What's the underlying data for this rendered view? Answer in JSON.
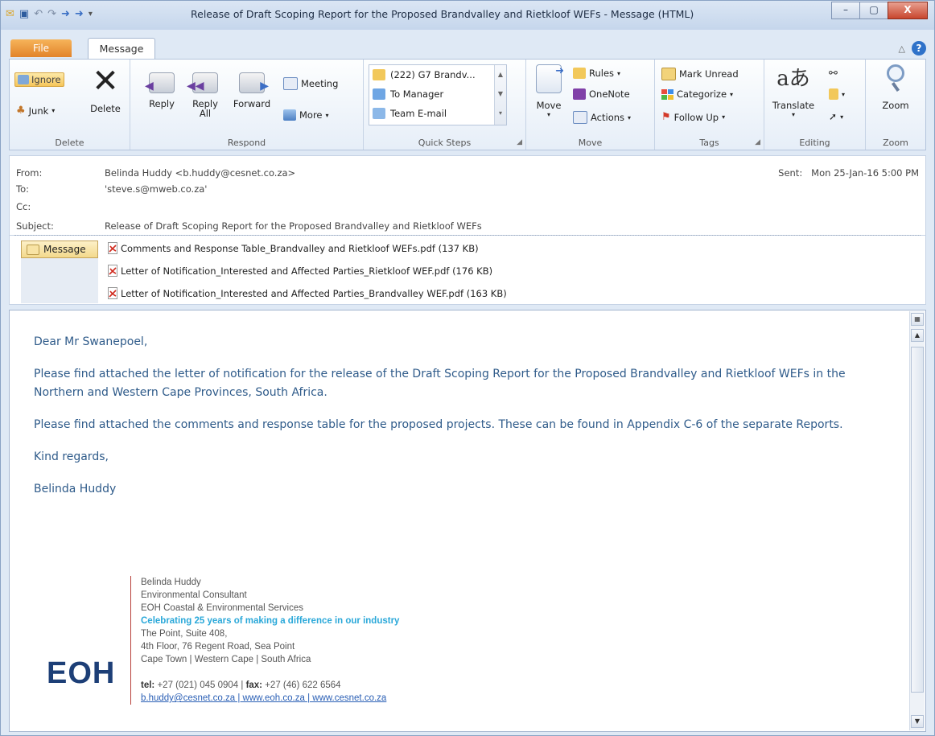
{
  "window": {
    "title": "Release of Draft Scoping Report for the Proposed Brandvalley and Rietkloof WEFs - Message (HTML)",
    "controls": [
      "–",
      "▢",
      "X"
    ]
  },
  "tabs": {
    "file": "File",
    "message": "Message"
  },
  "ribbon": {
    "delete_group": {
      "label": "Delete",
      "ignore": "Ignore",
      "junk": "Junk",
      "delete": "Delete"
    },
    "respond_group": {
      "label": "Respond",
      "reply": "Reply",
      "reply_all_1": "Reply",
      "reply_all_2": "All",
      "forward": "Forward",
      "meeting": "Meeting",
      "more": "More"
    },
    "quick_steps_group": {
      "label": "Quick Steps",
      "items": [
        "(222) G7 Brandv...",
        "To Manager",
        "Team E-mail"
      ]
    },
    "move_group": {
      "label": "Move",
      "move": "Move",
      "rules": "Rules",
      "onenote": "OneNote",
      "actions": "Actions"
    },
    "tags_group": {
      "label": "Tags",
      "mark_unread": "Mark Unread",
      "categorize": "Categorize",
      "follow_up": "Follow Up"
    },
    "editing_group": {
      "label": "Editing",
      "translate": "Translate"
    },
    "zoom_group": {
      "label": "Zoom",
      "zoom": "Zoom"
    }
  },
  "header": {
    "from_label": "From:",
    "from_value": "Belinda Huddy <b.huddy@cesnet.co.za>",
    "to_label": "To:",
    "to_value": "'steve.s@mweb.co.za'",
    "cc_label": "Cc:",
    "cc_value": "",
    "subject_label": "Subject:",
    "subject_value": "Release of Draft Scoping Report for the Proposed Brandvalley and Rietkloof WEFs",
    "sent_label": "Sent:",
    "sent_value": "Mon 25-Jan-16 5:00 PM"
  },
  "attachments": {
    "message_button": "Message",
    "files": [
      "Comments and Response Table_Brandvalley and Rietkloof WEFs.pdf (137 KB)",
      "Letter of Notification_Interested and Affected Parties_Rietkloof WEF.pdf (176 KB)",
      "Letter of Notification_Interested and Affected Parties_Brandvalley WEF.pdf (163 KB)"
    ]
  },
  "body": {
    "greeting": "Dear Mr Swanepoel,",
    "paragraph1": "Please find attached the letter of notification for the release of the Draft Scoping Report for the Proposed Brandvalley and Rietkloof WEFs in the Northern and Western Cape Provinces, South Africa.",
    "paragraph2": "Please find attached the comments and response table for the proposed projects. These can be found in Appendix C-6 of the separate Reports.",
    "closing": "Kind regards,",
    "signoff": "Belinda Huddy"
  },
  "signature": {
    "name": "Belinda Huddy",
    "role": "Environmental Consultant",
    "company": "EOH Coastal & Environmental Services",
    "slogan": "Celebrating 25 years of making a difference in our industry",
    "address1": "The Point, Suite 408,",
    "address2": "4th Floor, 76 Regent Road, Sea Point",
    "address3": "Cape Town  | Western Cape  |  South Africa",
    "tel_label": "tel:",
    "tel_value": "+27 (021) 045 0904 |",
    "fax_label": "fax:",
    "fax_value": "+27 (46) 622 6564",
    "links": "b.huddy@cesnet.co.za   |  www.eoh.co.za   |  www.cesnet.co.za",
    "logo_text": "EOH"
  }
}
